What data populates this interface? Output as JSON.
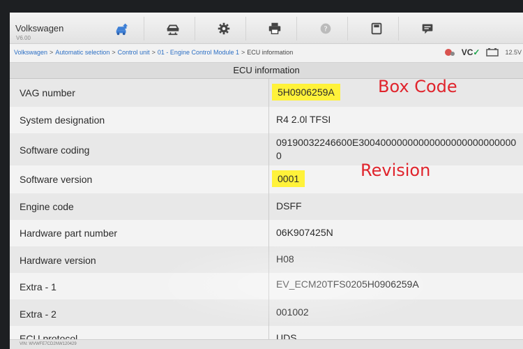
{
  "app": {
    "title": "Volkswagen",
    "version": "V6.00"
  },
  "toolbar": [
    {
      "icon": "car-home-icon"
    },
    {
      "icon": "car-lift-icon"
    },
    {
      "icon": "gear-icon"
    },
    {
      "icon": "printer-icon"
    },
    {
      "icon": "help-icon"
    },
    {
      "icon": "save-icon"
    },
    {
      "icon": "message-icon"
    }
  ],
  "breadcrumb": {
    "items": [
      "Volkswagen",
      "Automatic selection",
      "Control unit",
      "01 - Engine Control Module 1"
    ],
    "current": "ECU information"
  },
  "status": {
    "vci": "VC",
    "battery": "12.5V"
  },
  "section_title": "ECU information",
  "rows": [
    {
      "label": "VAG number",
      "value": "5H0906259A",
      "highlight": true
    },
    {
      "label": "System designation",
      "value": "R4 2.0l TFSI"
    },
    {
      "label": "Software coding",
      "value": "09190032246600E300400000000000000000000000000"
    },
    {
      "label": "Software version",
      "value": "0001",
      "highlight": true
    },
    {
      "label": "Engine code",
      "value": "DSFF"
    },
    {
      "label": "Hardware part number",
      "value": "06K907425N"
    },
    {
      "label": "Hardware version",
      "value": "H08"
    },
    {
      "label": "Extra - 1",
      "value": "EV_ECM20TFS0205H0906259A"
    },
    {
      "label": "Extra - 2",
      "value": "001002"
    },
    {
      "label": "ECU protocol",
      "value": "UDS"
    }
  ],
  "annotations": {
    "box_code": "Box Code",
    "revision": "Revision"
  },
  "footer": {
    "vin": "VIN: WVWFE7CD2NW120429"
  },
  "colors": {
    "highlight": "#fff23a",
    "annotation": "#e0242c",
    "link": "#2c6fc4"
  }
}
